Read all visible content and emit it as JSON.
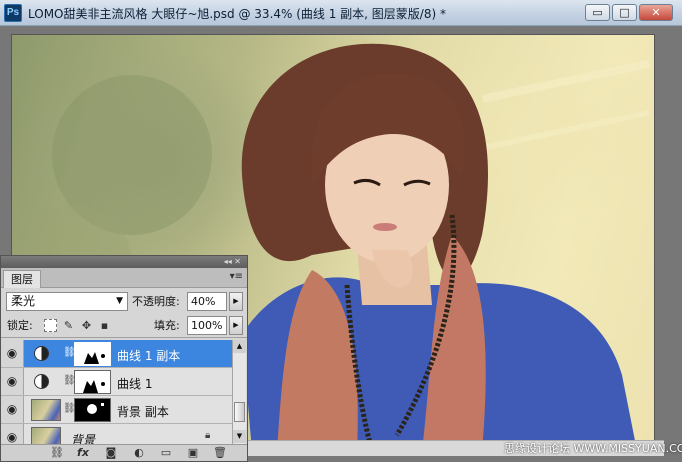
{
  "window": {
    "title": "LOMO甜美非主流风格  大眼仔~旭.psd @ 33.4% (曲线 1 副本, 图层蒙版/8) *",
    "app_icon_label": "Ps",
    "minimize_glyph": "▭",
    "maximize_glyph": "□",
    "close_glyph": "✕"
  },
  "canvas": {
    "zoom_percent": 33.4,
    "watermark": "思缘设计论坛  WWW.MISSYUAN.COM"
  },
  "layers_panel": {
    "collapse_glyph": "◂◂ ✕",
    "tab_label": "图层",
    "menu_glyph": "▾≡",
    "blend_mode": "柔光",
    "opacity_label": "不透明度:",
    "opacity_value": "40%",
    "lock_label": "锁定:",
    "fill_label": "填充:",
    "fill_value": "100%",
    "layers": [
      {
        "name": "曲线 1 副本",
        "type": "adjustment",
        "selected": true,
        "visible": true
      },
      {
        "name": "曲线 1",
        "type": "adjustment",
        "selected": false,
        "visible": true
      },
      {
        "name": "背景 副本",
        "type": "image",
        "selected": false,
        "visible": true
      },
      {
        "name": "背景",
        "type": "image",
        "selected": false,
        "visible": true,
        "locked": true
      }
    ],
    "footer_icons": [
      "link-icon",
      "fx-icon",
      "mask-icon",
      "adjustment-icon",
      "folder-icon",
      "new-layer-icon",
      "trash-icon"
    ]
  },
  "colors": {
    "selection": "#3d86e0",
    "panel_bg": "#d6d6d6"
  }
}
